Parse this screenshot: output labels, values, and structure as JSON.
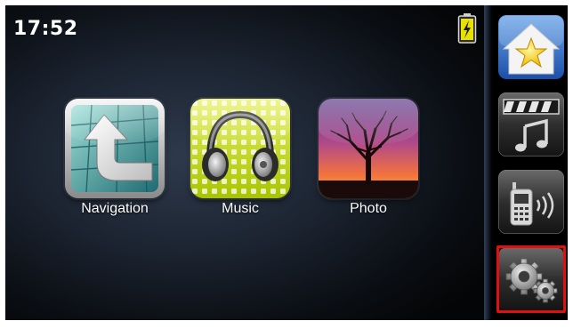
{
  "status_bar": {
    "time": "17:52",
    "battery": "charging-battery-icon"
  },
  "apps": [
    {
      "id": "navigation",
      "label": "Navigation",
      "icon": "navigation-arrow-icon"
    },
    {
      "id": "music",
      "label": "Music",
      "icon": "headphones-icon"
    },
    {
      "id": "photo",
      "label": "Photo",
      "icon": "sunset-tree-photo-icon"
    }
  ],
  "sidebar": {
    "items": [
      {
        "id": "favorites",
        "icon": "home-star-icon"
      },
      {
        "id": "media",
        "icon": "film-music-note-icon"
      },
      {
        "id": "phone",
        "icon": "phone-icon"
      },
      {
        "id": "settings",
        "icon": "gears-icon",
        "selected": true
      }
    ]
  },
  "colors": {
    "highlight": "#e01010",
    "battery": "#e8e000",
    "accent_blue": "#2a6fd0"
  }
}
